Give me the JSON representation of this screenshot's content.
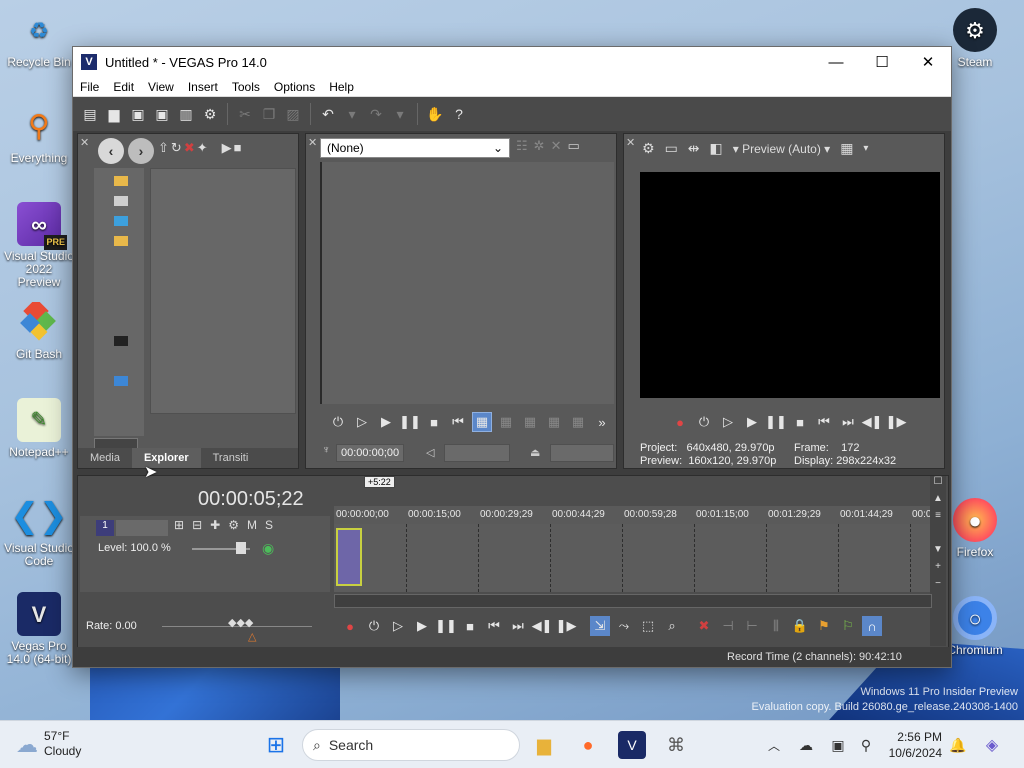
{
  "desktop": {
    "icons": [
      {
        "label": "Recycle Bin"
      },
      {
        "label": "Everything"
      },
      {
        "label": "Visual Studio 2022 Preview",
        "badge": "PRE"
      },
      {
        "label": "Git Bash"
      },
      {
        "label": "Notepad++"
      },
      {
        "label": "Visual Studio Code"
      },
      {
        "label": "Vegas Pro 14.0 (64-bit)"
      },
      {
        "label": "Steam"
      },
      {
        "label": "Firefox"
      },
      {
        "label": "Chromium"
      }
    ],
    "watermark_line1": "Windows 11 Pro Insider Preview",
    "watermark_line2": "Evaluation copy. Build 26080.ge_release.240308-1400"
  },
  "window": {
    "title": "Untitled * - VEGAS Pro 14.0",
    "menu": [
      "File",
      "Edit",
      "View",
      "Insert",
      "Tools",
      "Options",
      "Help"
    ]
  },
  "explorer": {
    "tabs": [
      "Media",
      "Explorer",
      "Transiti"
    ],
    "active_tab": "Explorer"
  },
  "trimmer": {
    "dropdown_value": "(None)",
    "timecode": "00:00:00;00"
  },
  "preview": {
    "mode": "Preview (Auto)",
    "project_label": "Project:",
    "project_value": "640x480, 29.970p",
    "preview_label": "Preview:",
    "preview_value": "160x120, 29.970p",
    "frame_label": "Frame:",
    "frame_value": "172",
    "display_label": "Display:",
    "display_value": "298x224x32"
  },
  "timeline": {
    "current_time": "00:00:05;22",
    "cursor_label": "+5:22",
    "ruler": [
      "00:00:00;00",
      "00:00:15;00",
      "00:00:29;29",
      "00:00:44;29",
      "00:00:59;28",
      "00:01:15;00",
      "00:01:29;29",
      "00:01:44;29",
      "00:0"
    ],
    "track_number": "1",
    "level": "Level: 100.0 %",
    "rate": "Rate: 0.00"
  },
  "status": {
    "record_time": "Record Time (2 channels): 90:42:10"
  },
  "taskbar": {
    "weather_temp": "57°F",
    "weather_desc": "Cloudy",
    "search_placeholder": "Search",
    "time": "2:56 PM",
    "date": "10/6/2024"
  }
}
